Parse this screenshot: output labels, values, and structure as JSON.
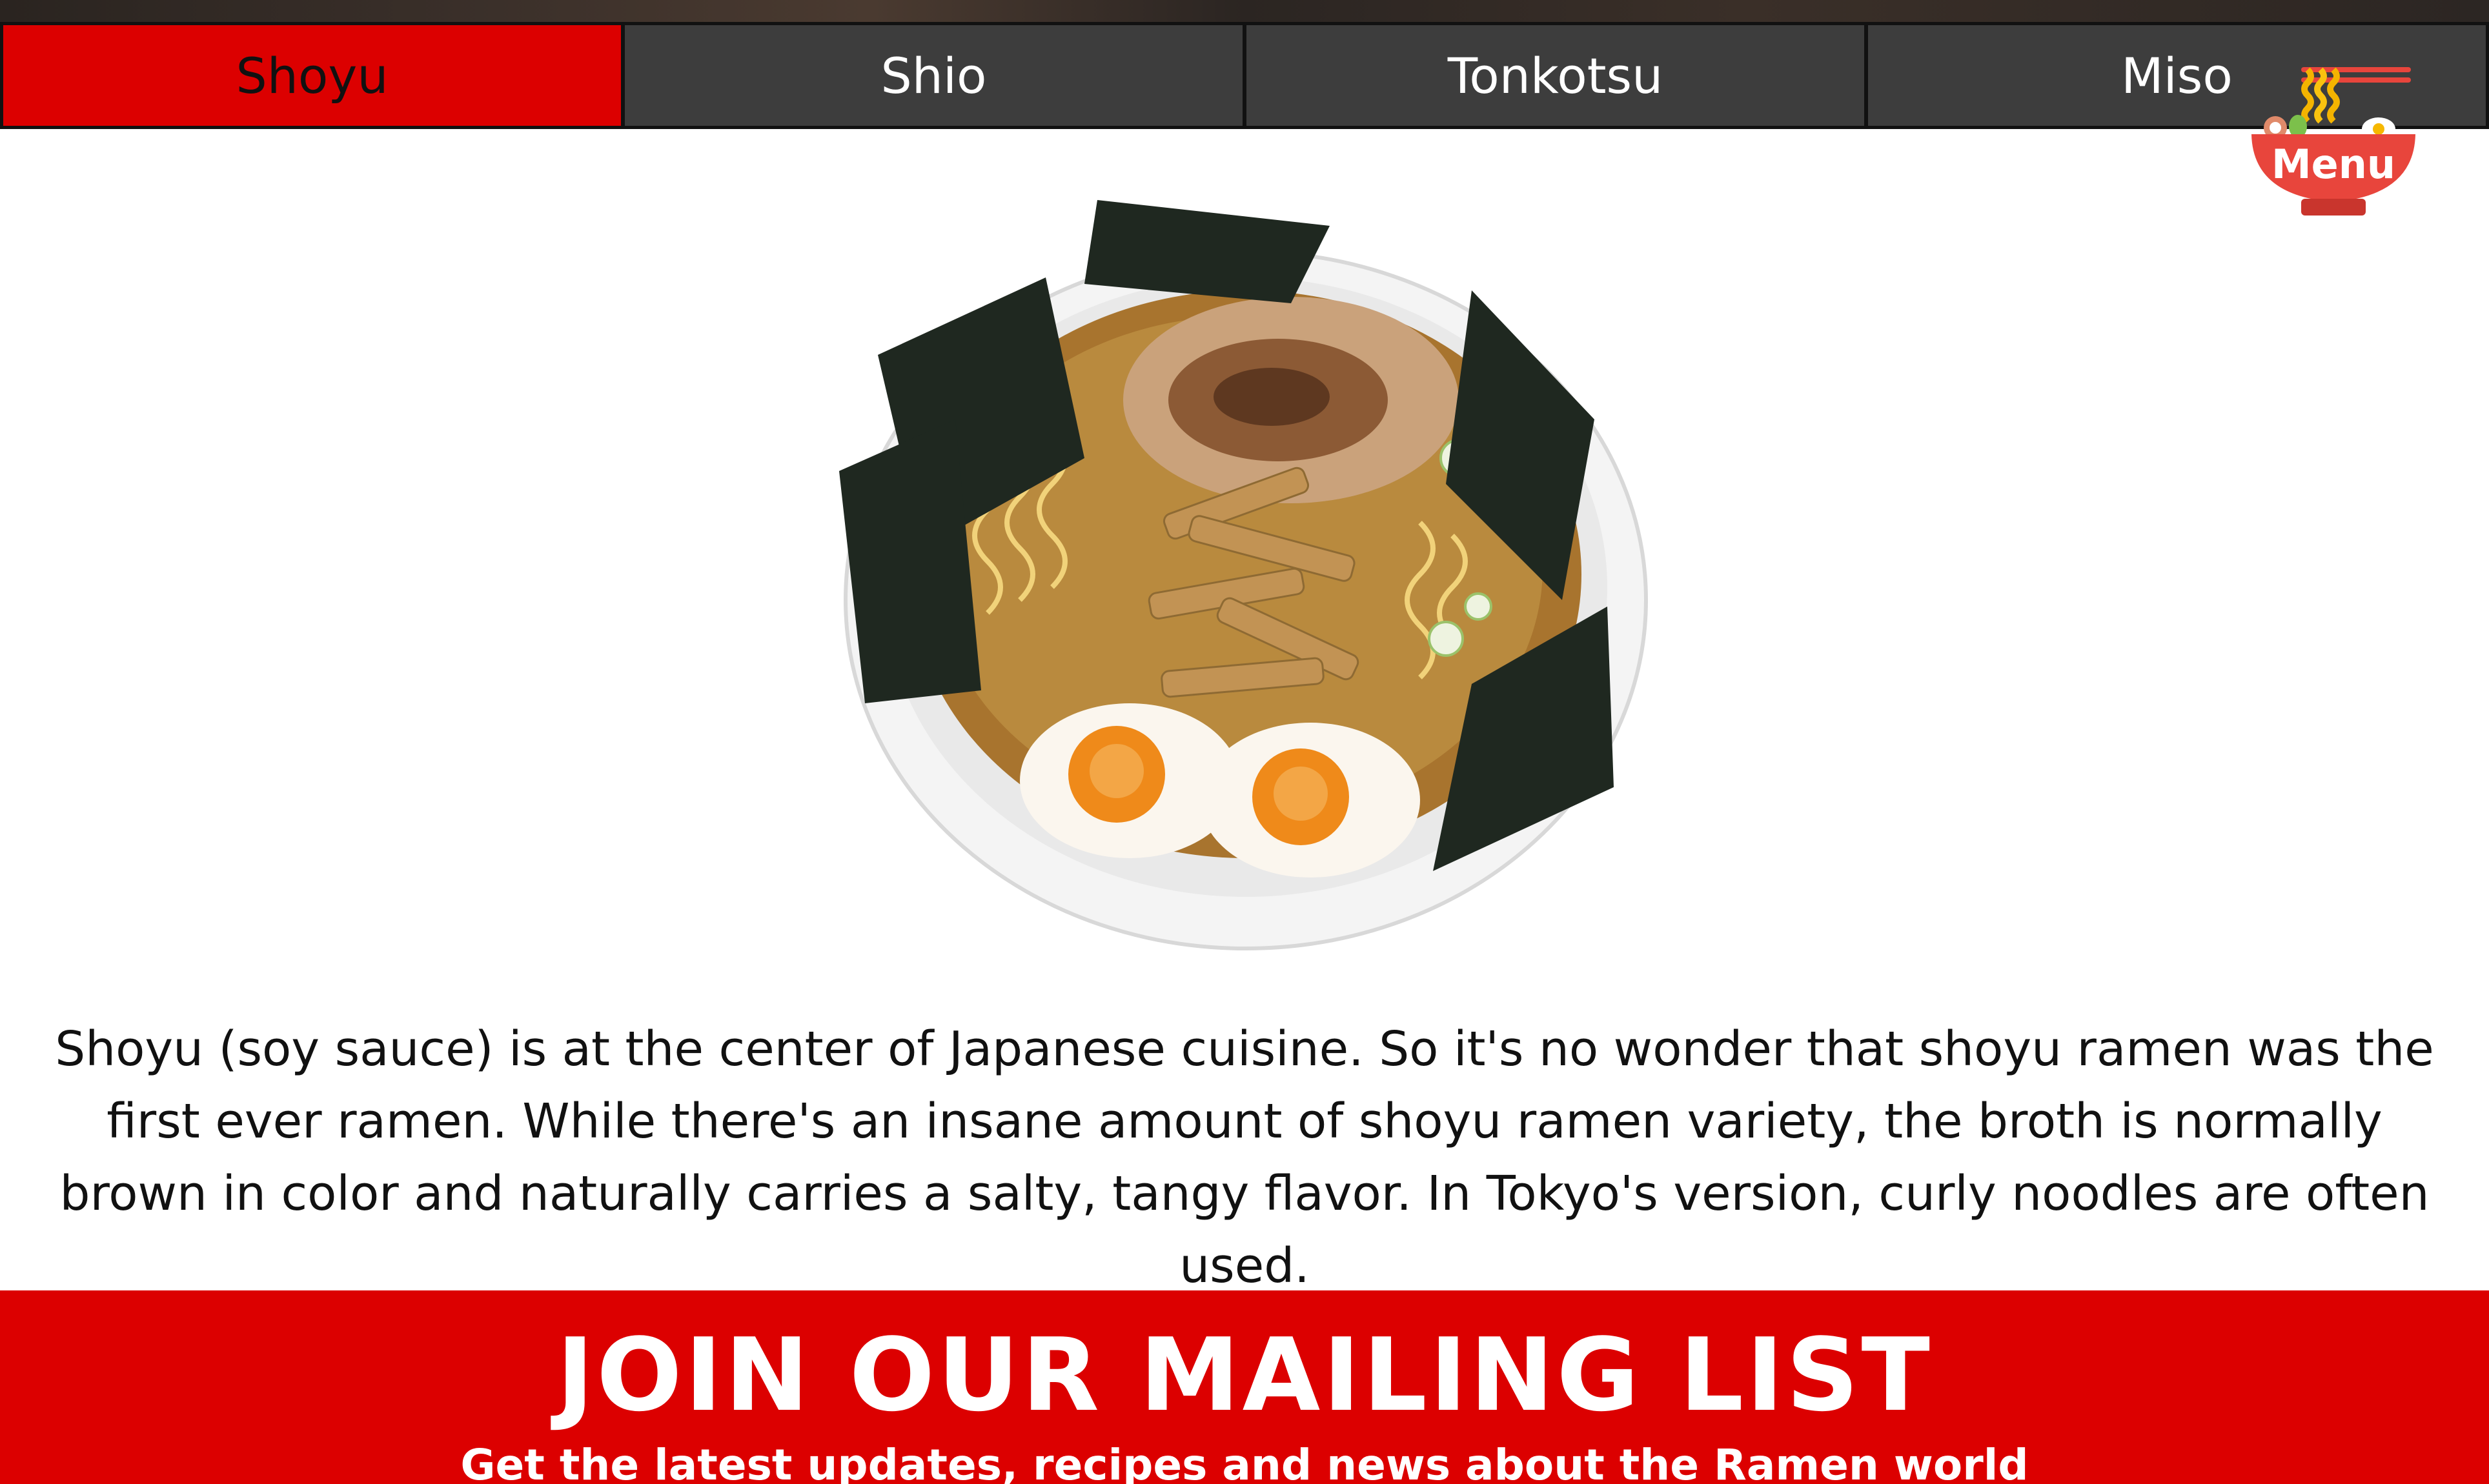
{
  "tabs": [
    {
      "label": "Shoyu",
      "active": true
    },
    {
      "label": "Shio",
      "active": false
    },
    {
      "label": "Tonkotsu",
      "active": false
    },
    {
      "label": "Miso",
      "active": false
    }
  ],
  "menu": {
    "label": "Menu",
    "icon": "ramen-bowl-icon"
  },
  "main": {
    "image": "shoyu-ramen-bowl",
    "description": "Shoyu (soy sauce) is at the center of Japanese cuisine. So it's no wonder that shoyu ramen was the first ever ramen. While there's an insane amount of shoyu ramen variety, the broth is normally brown in color and naturally carries a salty, tangy flavor. In Tokyo's version, curly noodles are often used."
  },
  "mailing": {
    "title": "JOIN OUR MAILING LIST",
    "subtitle": "Get the latest updates, recipes and news about the Ramen world"
  },
  "colors": {
    "accent": "#dc0000",
    "tab_bg": "#3d3d3d",
    "text": "#111111"
  }
}
